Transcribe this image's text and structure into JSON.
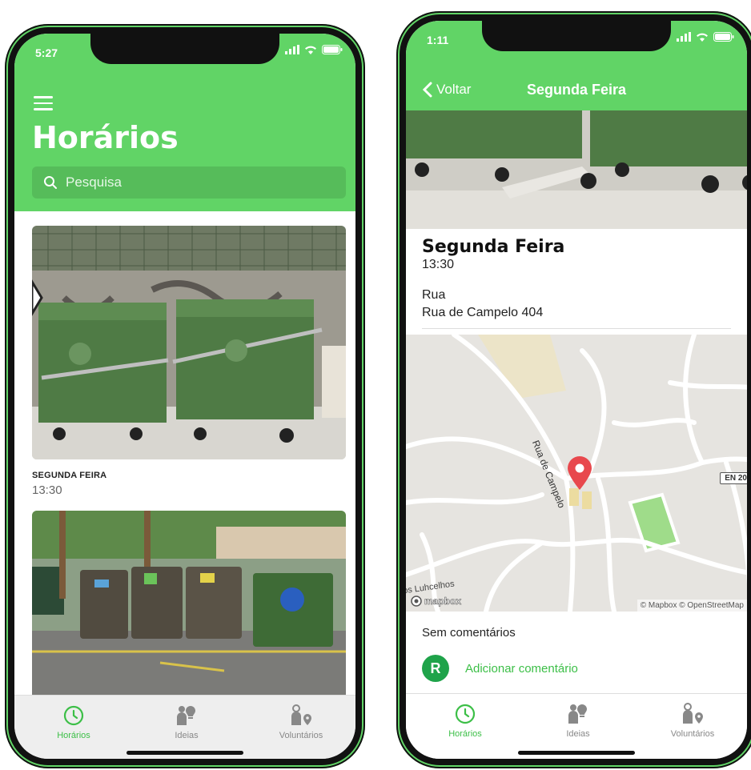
{
  "phone1": {
    "status": {
      "time": "5:27"
    },
    "title": "Horários",
    "search": {
      "placeholder": "Pesquisa"
    },
    "cards": [
      {
        "day": "SEGUNDA FEIRA",
        "time": "13:30"
      },
      {
        "day": "",
        "time": ""
      }
    ],
    "tabs": [
      {
        "label": "Horários",
        "icon": "clock-icon",
        "active": true
      },
      {
        "label": "Ideias",
        "icon": "people-idea-icon",
        "active": false
      },
      {
        "label": "Voluntários",
        "icon": "person-pin-icon",
        "active": false
      }
    ]
  },
  "phone2": {
    "status": {
      "time": "1:11"
    },
    "nav": {
      "back_label": "Voltar",
      "title": "Segunda Feira"
    },
    "detail": {
      "title": "Segunda Feira",
      "time": "13:30",
      "street_label": "Rua",
      "street_value": "Rua de Campelo 404"
    },
    "map": {
      "street_label": "Rua de Campelo",
      "road_badge": "EN 20",
      "place_label": "os Luhcelhos",
      "logo": "mapbox",
      "attribution": "© Mapbox © OpenStreetMap"
    },
    "comments": {
      "empty_text": "Sem comentários",
      "avatar_initial": "R",
      "add_label": "Adicionar comentário"
    },
    "tabs": [
      {
        "label": "Horários",
        "icon": "clock-icon",
        "active": true
      },
      {
        "label": "Ideias",
        "icon": "people-idea-icon",
        "active": false
      },
      {
        "label": "Voluntários",
        "icon": "person-pin-icon",
        "active": false
      }
    ]
  },
  "colors": {
    "accent": "#61d466",
    "accent_dark": "#3cbf47",
    "avatar": "#1fa34a",
    "map_pin": "#e8484d"
  }
}
